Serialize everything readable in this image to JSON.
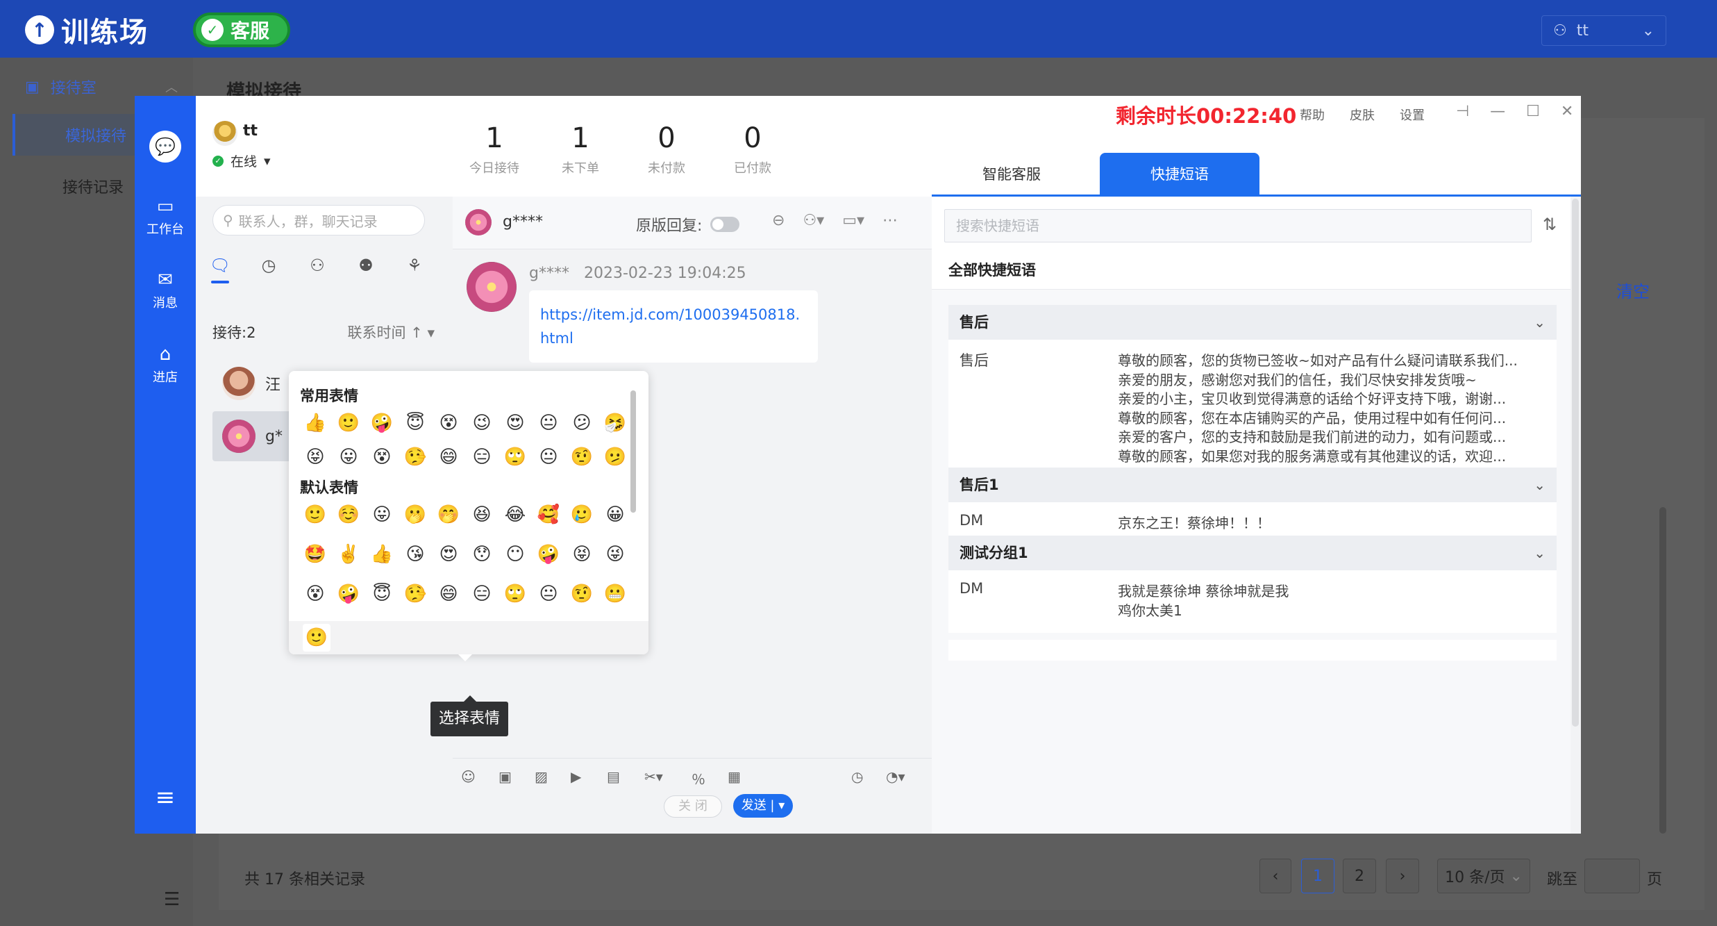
{
  "app": {
    "logo_text": "训练场",
    "service_badge": "客服",
    "user": "tt",
    "nav_group": "接待室",
    "nav_items": [
      "模拟接待",
      "接待记录"
    ],
    "page_title": "模拟接待",
    "clear_link": "清空",
    "footer_total": "共 17 条相关记录",
    "pagination": {
      "pages": [
        "1",
        "2"
      ],
      "current": "1",
      "page_size": "10 条/页",
      "jump_label": "跳至",
      "page_suffix": "页"
    }
  },
  "window": {
    "rail": [
      {
        "label": "工作台",
        "icon": "dashboard-icon"
      },
      {
        "label": "消息",
        "icon": "mail-icon"
      },
      {
        "label": "进店",
        "icon": "store-icon"
      }
    ],
    "agent": {
      "name": "tt",
      "status": "在线"
    },
    "search_placeholder": "联系人，群，聊天记录",
    "reception_label": "接待:2",
    "sort_label": "联系时间",
    "conversations": [
      {
        "name": "汪",
        "avatar": "person"
      },
      {
        "name": "g*",
        "avatar": "flower"
      }
    ],
    "stats": [
      {
        "value": "1",
        "label": "今日接待"
      },
      {
        "value": "1",
        "label": "未下单"
      },
      {
        "value": "0",
        "label": "未付款"
      },
      {
        "value": "0",
        "label": "已付款"
      }
    ],
    "chat": {
      "contact": "g****",
      "original_reply_label": "原版回复:",
      "message": {
        "sender": "g****",
        "time": "2023-02-23 19:04:25",
        "text": "https://item.jd.com/100039450818.html"
      },
      "close_button": "关 闭",
      "send_button": "发送 |"
    },
    "emoji_picker": {
      "common_title": "常用表情",
      "default_title": "默认表情",
      "common": [
        "👍",
        "🙂",
        "🤪",
        "😇",
        "😵",
        "😉",
        "😍",
        "😐",
        "😕",
        "🤧",
        "😝",
        "😛",
        "😵",
        "🤥",
        "😄",
        "😑",
        "🙄",
        "😐",
        "🤨",
        "🫤"
      ],
      "default": [
        "🙂",
        "☺️",
        "😛",
        "🫢",
        "🤭",
        "😆",
        "😂",
        "🥰",
        "🥲",
        "😀",
        "🤩",
        "✌️",
        "👍",
        "😘",
        "😍",
        "😯",
        "😶",
        "🤪",
        "😝",
        "😜",
        "😵",
        "🤪",
        "😇",
        "🤥",
        "😄",
        "😑",
        "🙄",
        "😐",
        "🤨",
        "😬"
      ],
      "footer_selected": "🙂"
    },
    "tooltip": "选择表情",
    "right_panel": {
      "countdown": "剩余时长00:22:40",
      "links": [
        "帮助",
        "皮肤",
        "设置"
      ],
      "tabs": [
        "智能客服",
        "快捷短语"
      ],
      "active_tab": "快捷短语",
      "search_placeholder": "搜索快捷短语",
      "all_label": "全部快捷短语",
      "groups": [
        {
          "title": "售后",
          "key": "售后",
          "lines": [
            "尊敬的顾客，您的货物已签收~如对产品有什么疑问请联系我们...",
            "亲爱的朋友，感谢您对我们的信任，我们尽快安排发货哦~",
            "亲爱的小主，宝贝收到觉得满意的话给个好评支持下哦，谢谢...",
            "尊敬的顾客，您在本店铺购买的产品，使用过程中如有任何问...",
            "亲爱的客户，您的支持和鼓励是我们前进的动力，如有问题或...",
            "尊敬的顾客，如果您对我的服务满意或有其他建议的话，欢迎..."
          ]
        },
        {
          "title": "售后1",
          "key": "DM",
          "lines": [
            "京东之王！蔡徐坤！！！"
          ]
        },
        {
          "title": "测试分组1",
          "key": "DM",
          "lines": [
            "我就是蔡徐坤 蔡徐坤就是我",
            "鸡你太美1"
          ]
        }
      ]
    }
  },
  "colors": {
    "brand_blue": "#1e5eef",
    "countdown_red": "#f2262f",
    "online_green": "#23b14d",
    "topbar_blue": "#1d48b5"
  }
}
